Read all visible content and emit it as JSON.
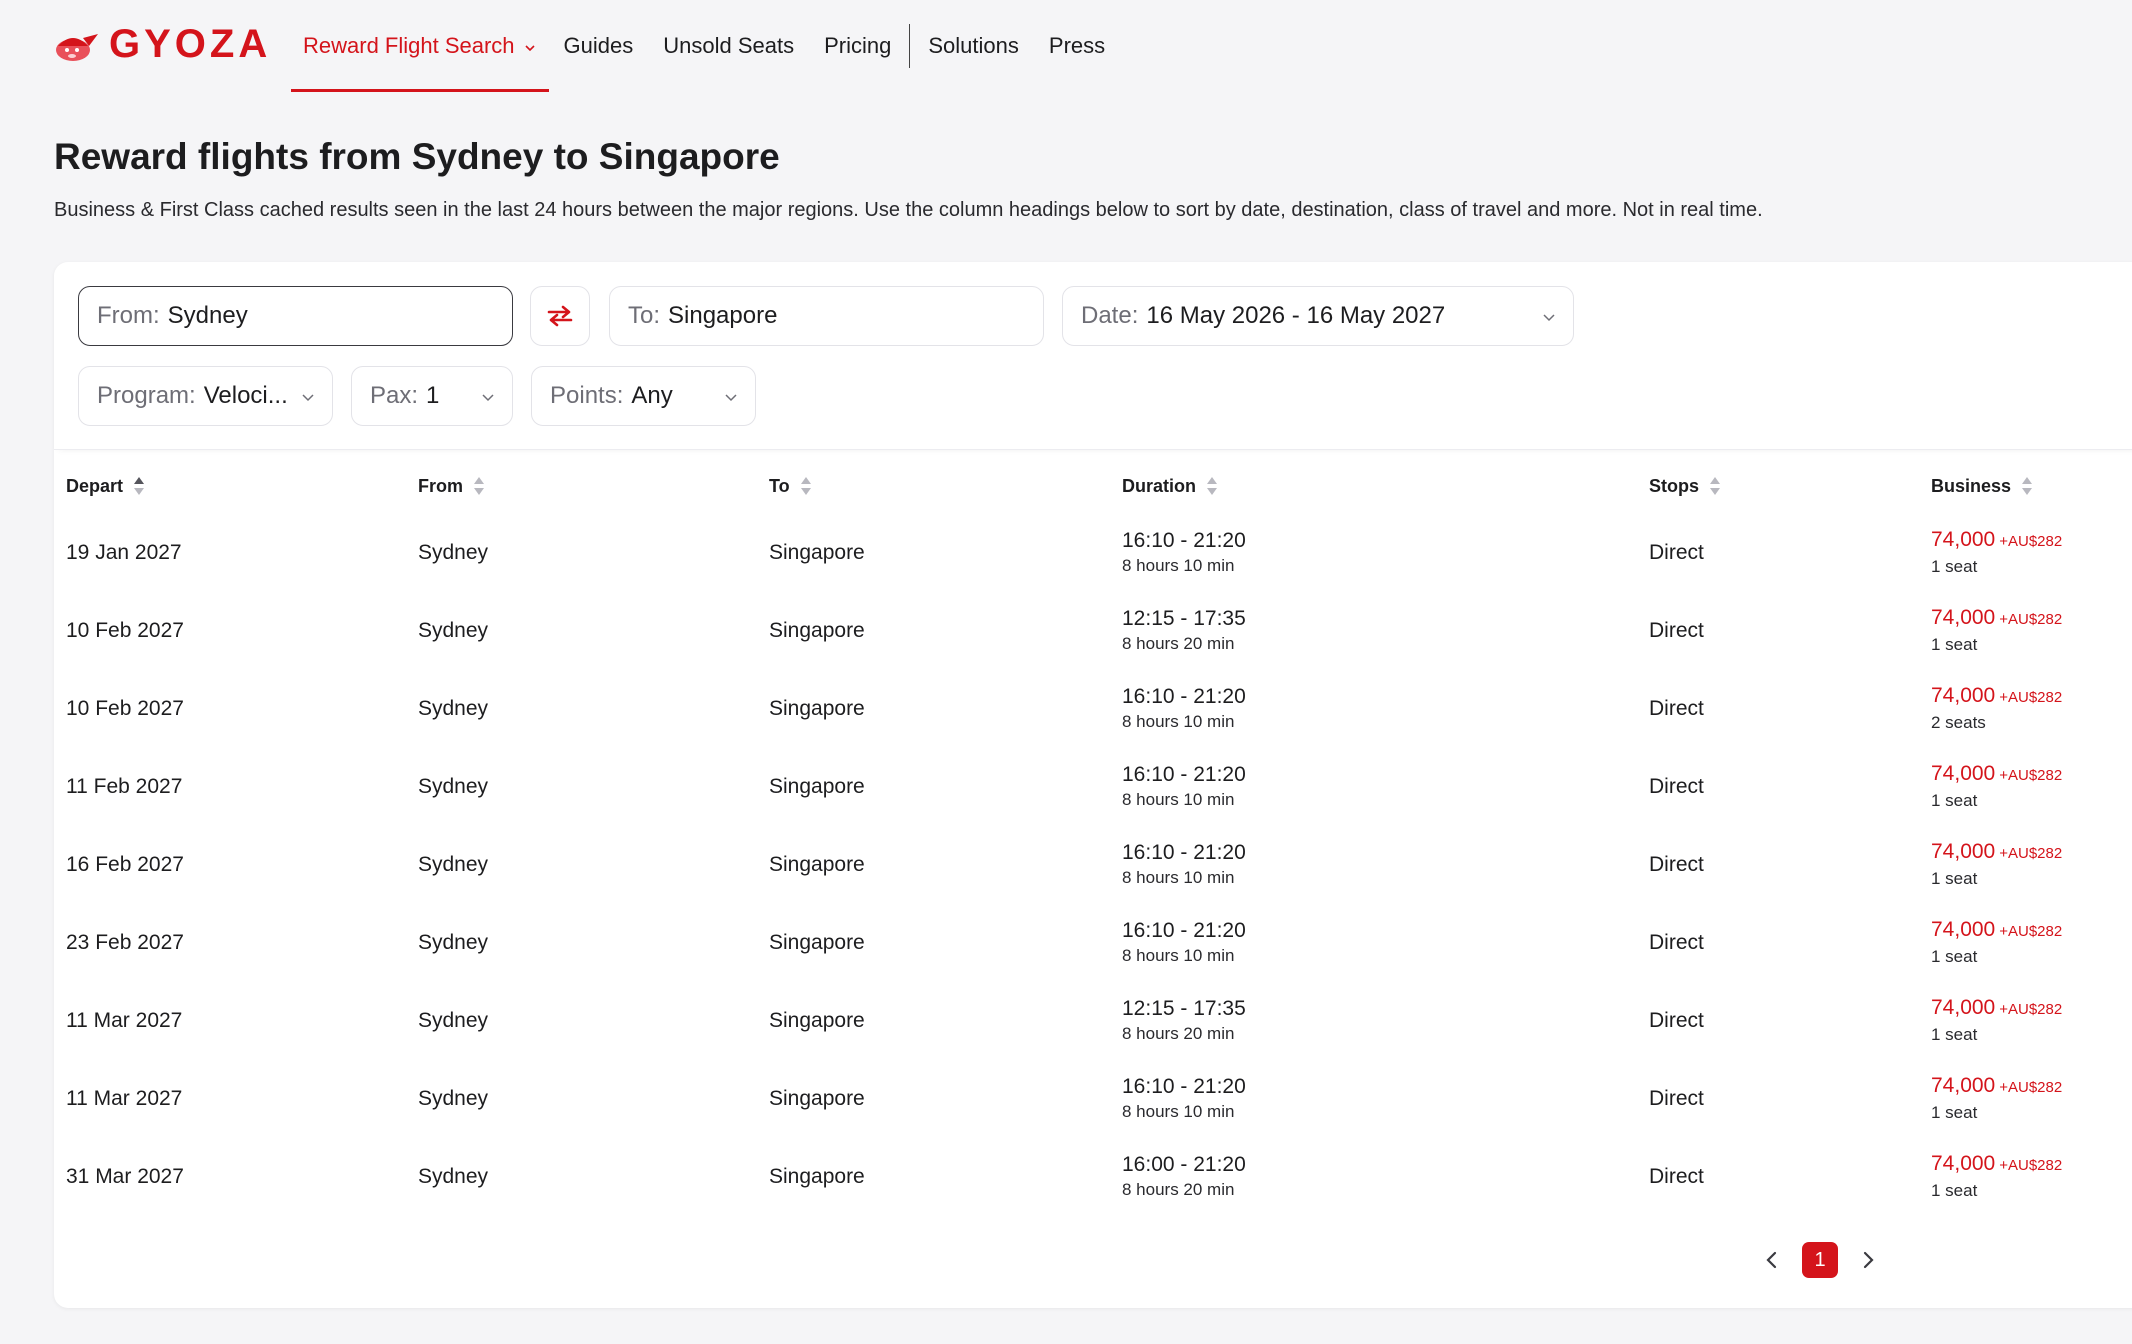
{
  "brand": {
    "name": "GYOZA",
    "accent": "#d4141b"
  },
  "nav": {
    "items": [
      {
        "label": "Reward Flight Search",
        "active": true,
        "has_dropdown": true
      },
      {
        "label": "Guides"
      },
      {
        "label": "Unsold Seats"
      },
      {
        "label": "Pricing"
      },
      {
        "label": "Solutions"
      },
      {
        "label": "Press"
      }
    ]
  },
  "page": {
    "title": "Reward flights from Sydney to Singapore",
    "description": "Business & First Class cached results seen in the last 24 hours between the major regions. Use the column headings below to sort by date, destination, class of travel and more. Not in real time."
  },
  "filters": {
    "from": {
      "label": "From:",
      "value": "Sydney"
    },
    "to": {
      "label": "To:",
      "value": "Singapore"
    },
    "date": {
      "label": "Date:",
      "value": "16 May 2026 - 16 May 2027"
    },
    "program": {
      "label": "Program:",
      "value": "Veloci..."
    },
    "pax": {
      "label": "Pax:",
      "value": "1"
    },
    "points": {
      "label": "Points:",
      "value": "Any"
    }
  },
  "table": {
    "headers": [
      "Depart",
      "From",
      "To",
      "Duration",
      "Stops",
      "Business"
    ],
    "rows": [
      {
        "depart": "19 Jan 2027",
        "from": "Sydney",
        "to": "Singapore",
        "times": "16:10 - 21:20",
        "duration": "8 hours 10 min",
        "stops": "Direct",
        "points": "74,000",
        "tax": "+AU$282",
        "seats": "1 seat"
      },
      {
        "depart": "10 Feb 2027",
        "from": "Sydney",
        "to": "Singapore",
        "times": "12:15 - 17:35",
        "duration": "8 hours 20 min",
        "stops": "Direct",
        "points": "74,000",
        "tax": "+AU$282",
        "seats": "1 seat"
      },
      {
        "depart": "10 Feb 2027",
        "from": "Sydney",
        "to": "Singapore",
        "times": "16:10 - 21:20",
        "duration": "8 hours 10 min",
        "stops": "Direct",
        "points": "74,000",
        "tax": "+AU$282",
        "seats": "2 seats"
      },
      {
        "depart": "11 Feb 2027",
        "from": "Sydney",
        "to": "Singapore",
        "times": "16:10 - 21:20",
        "duration": "8 hours 10 min",
        "stops": "Direct",
        "points": "74,000",
        "tax": "+AU$282",
        "seats": "1 seat"
      },
      {
        "depart": "16 Feb 2027",
        "from": "Sydney",
        "to": "Singapore",
        "times": "16:10 - 21:20",
        "duration": "8 hours 10 min",
        "stops": "Direct",
        "points": "74,000",
        "tax": "+AU$282",
        "seats": "1 seat"
      },
      {
        "depart": "23 Feb 2027",
        "from": "Sydney",
        "to": "Singapore",
        "times": "16:10 - 21:20",
        "duration": "8 hours 10 min",
        "stops": "Direct",
        "points": "74,000",
        "tax": "+AU$282",
        "seats": "1 seat"
      },
      {
        "depart": "11 Mar 2027",
        "from": "Sydney",
        "to": "Singapore",
        "times": "12:15 - 17:35",
        "duration": "8 hours 20 min",
        "stops": "Direct",
        "points": "74,000",
        "tax": "+AU$282",
        "seats": "1 seat"
      },
      {
        "depart": "11 Mar 2027",
        "from": "Sydney",
        "to": "Singapore",
        "times": "16:10 - 21:20",
        "duration": "8 hours 10 min",
        "stops": "Direct",
        "points": "74,000",
        "tax": "+AU$282",
        "seats": "1 seat"
      },
      {
        "depart": "31 Mar 2027",
        "from": "Sydney",
        "to": "Singapore",
        "times": "16:00 - 21:20",
        "duration": "8 hours 20 min",
        "stops": "Direct",
        "points": "74,000",
        "tax": "+AU$282",
        "seats": "1 seat"
      }
    ]
  },
  "pagination": {
    "current": "1"
  },
  "icons": {
    "logo": "gyoza-logo-icon",
    "swap": "swap-arrows-icon",
    "chevron": "chevron-down-icon",
    "sort": "sort-icon",
    "prev": "chevron-left-icon",
    "next": "chevron-right-icon"
  }
}
